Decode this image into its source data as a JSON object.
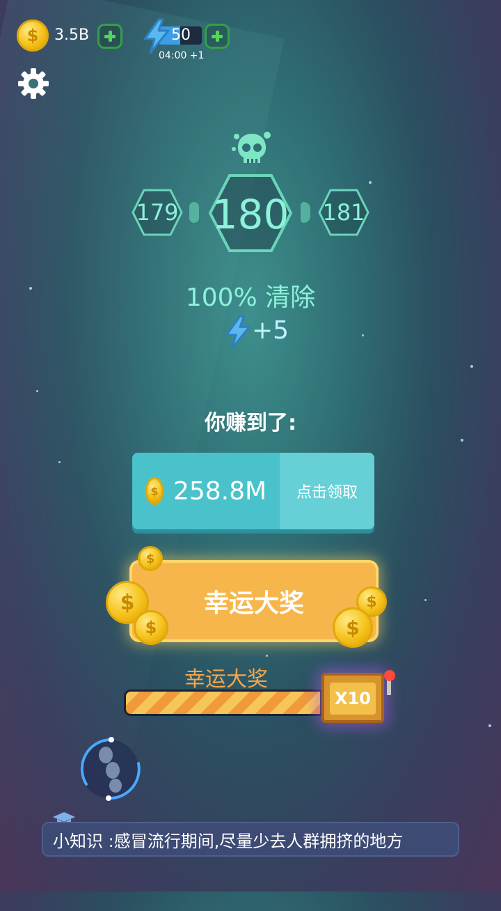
{
  "topbar": {
    "coins": "3.5B",
    "energy": "50",
    "energy_fill": 0.5,
    "energy_timer": "04:00 +1"
  },
  "level": {
    "prev": "179",
    "current": "180",
    "next": "181"
  },
  "result": {
    "clear_text": "100% 清除",
    "energy_bonus": "+5"
  },
  "reward": {
    "title": "你赚到了:",
    "amount": "258.8M",
    "claim_label": "点击领取"
  },
  "lucky": {
    "button_label": "幸运大奖",
    "bar_label": "幸运大奖",
    "multiplier": "X10",
    "progress": 0.95
  },
  "tip": {
    "text": "小知识 :感冒流行期间,尽量少去人群拥挤的地方"
  },
  "colors": {
    "accent": "#8cf2d9",
    "claim": "#4ac2cc",
    "lucky": "#f6b64c",
    "plus": "#54d45c"
  }
}
